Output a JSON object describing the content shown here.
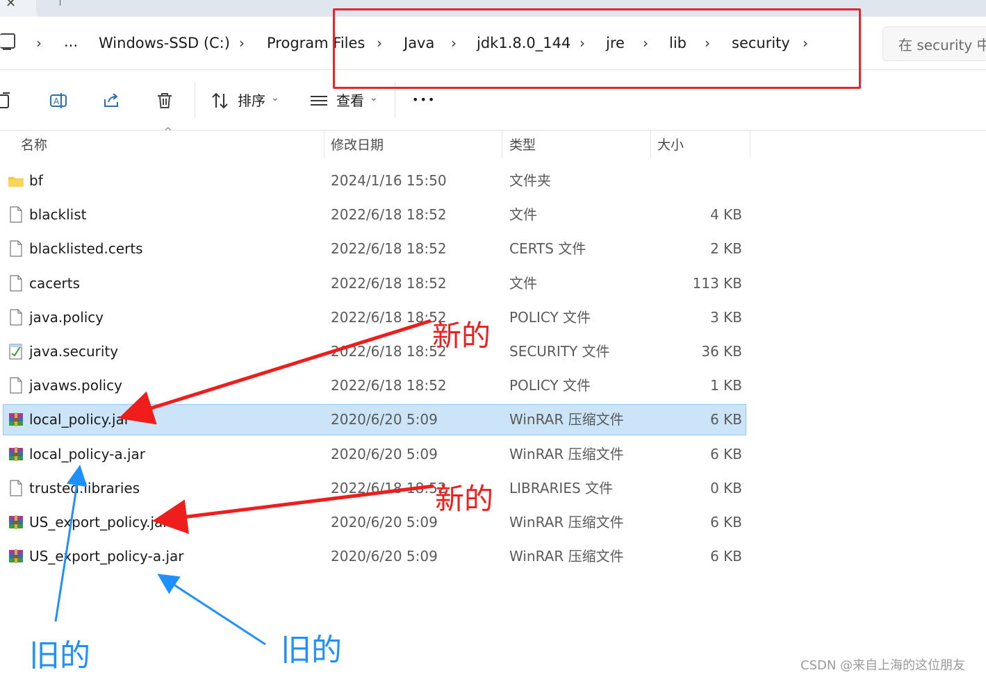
{
  "breadcrumb": {
    "overflow": "...",
    "items": [
      "Windows-SSD (C:)",
      "Program Files",
      "Java",
      "jdk1.8.0_144",
      "jre",
      "lib",
      "security"
    ]
  },
  "search": {
    "placeholder": "在 security 中"
  },
  "toolbar": {
    "sort_label": "排序",
    "view_label": "查看",
    "more_label": "•••"
  },
  "columns": {
    "name": "名称",
    "date": "修改日期",
    "type": "类型",
    "size": "大小"
  },
  "files": [
    {
      "name": "bf",
      "date": "2024/1/16 15:50",
      "type": "文件夹",
      "size": "",
      "icon": "folder-icon"
    },
    {
      "name": "blacklist",
      "date": "2022/6/18 18:52",
      "type": "文件",
      "size": "4 KB",
      "icon": "file-icon"
    },
    {
      "name": "blacklisted.certs",
      "date": "2022/6/18 18:52",
      "type": "CERTS 文件",
      "size": "2 KB",
      "icon": "file-icon"
    },
    {
      "name": "cacerts",
      "date": "2022/6/18 18:52",
      "type": "文件",
      "size": "113 KB",
      "icon": "file-icon"
    },
    {
      "name": "java.policy",
      "date": "2022/6/18 18:52",
      "type": "POLICY 文件",
      "size": "3 KB",
      "icon": "file-icon"
    },
    {
      "name": "java.security",
      "date": "2022/6/18 18:52",
      "type": "SECURITY 文件",
      "size": "36 KB",
      "icon": "notepad-icon"
    },
    {
      "name": "javaws.policy",
      "date": "2022/6/18 18:52",
      "type": "POLICY 文件",
      "size": "1 KB",
      "icon": "file-icon"
    },
    {
      "name": "local_policy.jar",
      "date": "2020/6/20 5:09",
      "type": "WinRAR 压缩文件",
      "size": "6 KB",
      "icon": "winrar-icon",
      "selected": true
    },
    {
      "name": "local_policy-a.jar",
      "date": "2020/6/20 5:09",
      "type": "WinRAR 压缩文件",
      "size": "6 KB",
      "icon": "winrar-icon"
    },
    {
      "name": "trusted.libraries",
      "date": "2022/6/18 18:52",
      "type": "LIBRARIES 文件",
      "size": "0 KB",
      "icon": "file-icon"
    },
    {
      "name": "US_export_policy.jar",
      "date": "2020/6/20 5:09",
      "type": "WinRAR 压缩文件",
      "size": "6 KB",
      "icon": "winrar-icon"
    },
    {
      "name": "US_export_policy-a.jar",
      "date": "2020/6/20 5:09",
      "type": "WinRAR 压缩文件",
      "size": "6 KB",
      "icon": "winrar-icon"
    }
  ],
  "annotations": {
    "new_1": "新的",
    "new_2": "新的",
    "old_1": "旧的",
    "old_2": "旧的"
  },
  "colors": {
    "selection": "#cce4f7",
    "annotation_red": "#f01d1d",
    "annotation_blue": "#1e90ff"
  },
  "watermark": "CSDN @来自上海的这位朋友"
}
